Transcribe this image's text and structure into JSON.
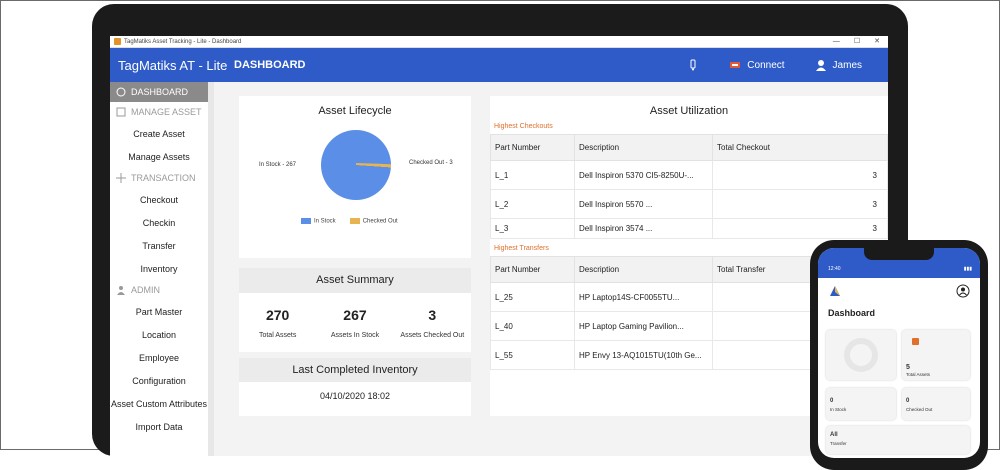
{
  "window": {
    "title": "TagMatiks Asset Tracking - Lite - Dashboard",
    "controls": [
      "—",
      "☐",
      "✕"
    ]
  },
  "app": {
    "brand": "TagMatiks AT - Lite",
    "page_title": "DASHBOARD",
    "connect_label": "Connect",
    "user_label": "James"
  },
  "sidebar": {
    "dashboard": "DASHBOARD",
    "manage_asset": "MANAGE ASSET",
    "create_asset": "Create Asset",
    "manage_assets": "Manage Assets",
    "transaction": "TRANSACTION",
    "checkout": "Checkout",
    "checkin": "Checkin",
    "transfer": "Transfer",
    "inventory": "Inventory",
    "admin": "ADMIN",
    "part_master": "Part Master",
    "location": "Location",
    "employee": "Employee",
    "configuration": "Configuration",
    "custom_attributes": "Asset Custom Attributes",
    "import_data": "Import Data"
  },
  "lifecycle": {
    "title": "Asset Lifecycle",
    "in_stock_label": "In Stock - 267",
    "checked_out_label": "Checked Out - 3",
    "legend_in_stock": "In Stock",
    "legend_checked_out": "Checked Out",
    "color_in_stock": "#5b8ee6",
    "color_checked_out": "#e6b450",
    "in_stock_value": 267,
    "checked_out_value": 3
  },
  "summary": {
    "title": "Asset Summary",
    "total_value": "270",
    "total_label": "Total Assets",
    "instock_value": "267",
    "instock_label": "Assets In Stock",
    "checkedout_value": "3",
    "checkedout_label": "Assets Checked Out"
  },
  "last_inventory": {
    "title": "Last Completed Inventory",
    "date": "04/10/2020 18:02"
  },
  "utilization": {
    "title": "Asset Utilization",
    "checkouts_label": "Highest Checkouts",
    "checkouts_headers": [
      "Part Number",
      "Description",
      "Total Checkout"
    ],
    "checkouts_rows": [
      [
        "L_1",
        "Dell Inspiron 5370 CI5-8250U-...",
        "3"
      ],
      [
        "L_2",
        "Dell Inspiron 5570 ...",
        "3"
      ],
      [
        "L_3",
        "Dell Inspiron 3574 ...",
        "3"
      ]
    ],
    "transfers_label": "Highest Transfers",
    "transfers_headers": [
      "Part Number",
      "Description",
      "Total Transfer"
    ],
    "transfers_rows": [
      [
        "L_25",
        "HP Laptop14S-CF0055TU...",
        ""
      ],
      [
        "L_40",
        "HP Laptop Gaming Pavilion...",
        ""
      ],
      [
        "L_55",
        "HP Envy 13-AQ1015TU(10th Ge...",
        ""
      ]
    ]
  },
  "phone": {
    "time": "12:40",
    "title": "Dashboard",
    "count1": "5",
    "count1_label": "Total Assets",
    "count2": "0",
    "count2_label": "In Stock",
    "count3": "0",
    "count3_label": "Checked Out",
    "count4": "All",
    "count4_label": "Transfer"
  }
}
